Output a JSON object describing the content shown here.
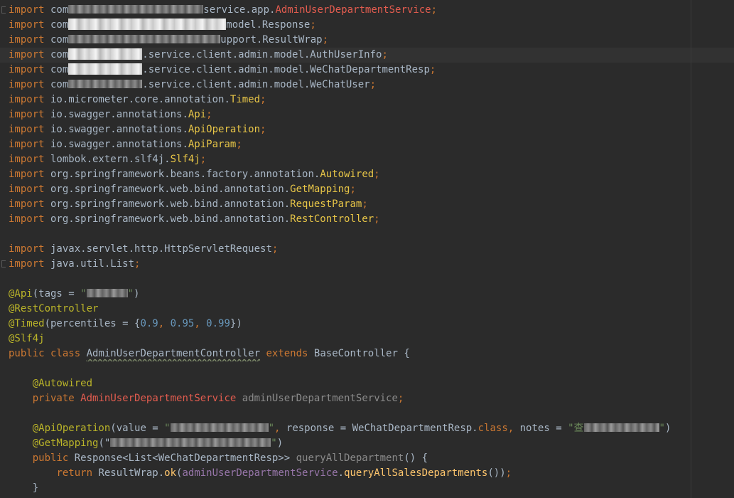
{
  "colors": {
    "background": "#2b2b2b",
    "keyword": "#cc7832",
    "annotation": "#bbb529",
    "class_name": "#e7c547",
    "unresolved": "#e25c4f",
    "string": "#6a8759",
    "number": "#6897bb",
    "field": "#9876aa",
    "method": "#ffc66d",
    "default_text": "#a9b7c6"
  },
  "editor": {
    "highlighted_line": 4,
    "lines": [
      [
        {
          "t": "import",
          "c": "kw"
        },
        {
          "t": " com"
        },
        {
          "m": 190
        },
        {
          "t": "service.app."
        },
        {
          "t": "AdminUserDepartmentService",
          "c": "err"
        },
        {
          "t": ";",
          "c": "kw"
        }
      ],
      [
        {
          "t": "import",
          "c": "kw"
        },
        {
          "t": " com"
        },
        {
          "m": 222,
          "lg": true
        },
        {
          "t": "model.Response"
        },
        {
          "t": ";",
          "c": "kw"
        }
      ],
      [
        {
          "t": "import",
          "c": "kw"
        },
        {
          "t": " com"
        },
        {
          "m": 214
        },
        {
          "t": "upport.ResultWrap"
        },
        {
          "t": ";",
          "c": "kw"
        }
      ],
      [
        {
          "t": "import",
          "c": "kw"
        },
        {
          "t": " com"
        },
        {
          "m": 104,
          "lg": true
        },
        {
          "t": ".service.client.admin.model.AuthUserInfo"
        },
        {
          "t": ";",
          "c": "kw"
        }
      ],
      [
        {
          "t": "import",
          "c": "kw"
        },
        {
          "t": " com"
        },
        {
          "m": 104,
          "lg": true
        },
        {
          "t": ".service.client.admin.model.WeChatDepartmentResp"
        },
        {
          "t": ";",
          "c": "kw"
        }
      ],
      [
        {
          "t": "import",
          "c": "kw"
        },
        {
          "t": " com"
        },
        {
          "m": 104
        },
        {
          "t": ".service.client.admin.model.WeChatUser"
        },
        {
          "t": ";",
          "c": "kw"
        }
      ],
      [
        {
          "t": "import",
          "c": "kw"
        },
        {
          "t": " io.micrometer.core.annotation."
        },
        {
          "t": "Timed",
          "c": "cls"
        },
        {
          "t": ";",
          "c": "kw"
        }
      ],
      [
        {
          "t": "import",
          "c": "kw"
        },
        {
          "t": " io.swagger.annotations."
        },
        {
          "t": "Api",
          "c": "cls"
        },
        {
          "t": ";",
          "c": "kw"
        }
      ],
      [
        {
          "t": "import",
          "c": "kw"
        },
        {
          "t": " io.swagger.annotations."
        },
        {
          "t": "ApiOperation",
          "c": "cls"
        },
        {
          "t": ";",
          "c": "kw"
        }
      ],
      [
        {
          "t": "import",
          "c": "kw"
        },
        {
          "t": " io.swagger.annotations."
        },
        {
          "t": "ApiParam",
          "c": "cls"
        },
        {
          "t": ";",
          "c": "kw"
        }
      ],
      [
        {
          "t": "import",
          "c": "kw"
        },
        {
          "t": " lombok.extern.slf4j."
        },
        {
          "t": "Slf4j",
          "c": "cls"
        },
        {
          "t": ";",
          "c": "kw"
        }
      ],
      [
        {
          "t": "import",
          "c": "kw"
        },
        {
          "t": " org.springframework.beans.factory.annotation."
        },
        {
          "t": "Autowired",
          "c": "cls"
        },
        {
          "t": ";",
          "c": "kw"
        }
      ],
      [
        {
          "t": "import",
          "c": "kw"
        },
        {
          "t": " org.springframework.web.bind.annotation."
        },
        {
          "t": "GetMapping",
          "c": "cls"
        },
        {
          "t": ";",
          "c": "kw"
        }
      ],
      [
        {
          "t": "import",
          "c": "kw"
        },
        {
          "t": " org.springframework.web.bind.annotation."
        },
        {
          "t": "RequestParam",
          "c": "cls"
        },
        {
          "t": ";",
          "c": "kw"
        }
      ],
      [
        {
          "t": "import",
          "c": "kw"
        },
        {
          "t": " org.springframework.web.bind.annotation."
        },
        {
          "t": "RestController",
          "c": "cls"
        },
        {
          "t": ";",
          "c": "kw"
        }
      ],
      [],
      [
        {
          "t": "import",
          "c": "kw"
        },
        {
          "t": " javax.servlet.http.HttpServletRequest"
        },
        {
          "t": ";",
          "c": "kw"
        }
      ],
      [
        {
          "t": "import",
          "c": "kw"
        },
        {
          "t": " java.util.List"
        },
        {
          "t": ";",
          "c": "kw"
        }
      ],
      [],
      [
        {
          "t": "@Api",
          "c": "ann"
        },
        {
          "t": "(tags = "
        },
        {
          "t": "\"",
          "c": "str"
        },
        {
          "m": 58
        },
        {
          "t": "\"",
          "c": "str"
        },
        {
          "t": ")"
        }
      ],
      [
        {
          "t": "@RestController",
          "c": "ann"
        }
      ],
      [
        {
          "t": "@Timed",
          "c": "ann"
        },
        {
          "t": "(percentiles = {"
        },
        {
          "t": "0.9",
          "c": "num"
        },
        {
          "t": ", ",
          "c": "kw"
        },
        {
          "t": "0.95",
          "c": "num"
        },
        {
          "t": ", ",
          "c": "kw"
        },
        {
          "t": "0.99",
          "c": "num"
        },
        {
          "t": "})"
        }
      ],
      [
        {
          "t": "@Slf4j",
          "c": "ann"
        }
      ],
      [
        {
          "t": "public class",
          "c": "kw"
        },
        {
          "t": " "
        },
        {
          "t": "AdminUserDepartmentController",
          "c": "wavy"
        },
        {
          "t": " "
        },
        {
          "t": "extends",
          "c": "kw"
        },
        {
          "t": " BaseController {"
        }
      ],
      [],
      [
        {
          "t": "    "
        },
        {
          "t": "@Autowired",
          "c": "ann"
        }
      ],
      [
        {
          "t": "    "
        },
        {
          "t": "private",
          "c": "kw"
        },
        {
          "t": " "
        },
        {
          "t": "AdminUserDepartmentService",
          "c": "err"
        },
        {
          "t": " "
        },
        {
          "t": "adminUserDepartmentService",
          "c": "gray"
        },
        {
          "t": ";",
          "c": "kw"
        }
      ],
      [],
      [
        {
          "t": "    "
        },
        {
          "t": "@ApiOperation",
          "c": "ann"
        },
        {
          "t": "(value = "
        },
        {
          "t": "\"",
          "c": "str"
        },
        {
          "m": 138
        },
        {
          "t": "\"",
          "c": "str"
        },
        {
          "t": ", ",
          "c": "kw"
        },
        {
          "t": "response = WeChatDepartmentResp."
        },
        {
          "t": "class",
          "c": "kw"
        },
        {
          "t": ", ",
          "c": "kw"
        },
        {
          "t": "notes = "
        },
        {
          "t": "\"查",
          "c": "str"
        },
        {
          "m": 106
        },
        {
          "t": "\"",
          "c": "str"
        },
        {
          "t": ")"
        }
      ],
      [
        {
          "t": "    "
        },
        {
          "t": "@GetMapping",
          "c": "ann"
        },
        {
          "t": "(\""
        },
        {
          "m": 226
        },
        {
          "t": "\"",
          "c": "str"
        },
        {
          "t": ")"
        }
      ],
      [
        {
          "t": "    "
        },
        {
          "t": "public",
          "c": "kw"
        },
        {
          "t": " Response<List<WeChatDepartmentResp>> "
        },
        {
          "t": "queryAllDepartment",
          "c": "gray"
        },
        {
          "t": "() {"
        }
      ],
      [
        {
          "t": "        "
        },
        {
          "t": "return",
          "c": "kw"
        },
        {
          "t": " ResultWrap."
        },
        {
          "t": "ok",
          "c": "mth"
        },
        {
          "t": "("
        },
        {
          "t": "adminUserDepartmentService",
          "c": "fld"
        },
        {
          "t": "."
        },
        {
          "t": "queryAllSalesDepartments",
          "c": "mth"
        },
        {
          "t": "())"
        },
        {
          "t": ";",
          "c": "kw"
        }
      ],
      [
        {
          "t": "    }"
        }
      ]
    ]
  }
}
